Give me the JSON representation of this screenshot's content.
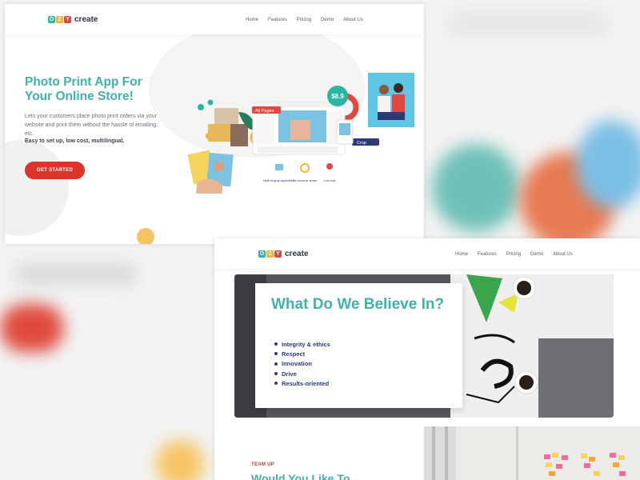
{
  "brand": {
    "letters": [
      "O",
      "Z",
      "Y"
    ],
    "word": "create",
    "colors": [
      "#2bb5a4",
      "#f4b43a",
      "#e2483d"
    ]
  },
  "nav": {
    "items": [
      "Home",
      "Features",
      "Pricing",
      "Demo",
      "About Us"
    ]
  },
  "hero": {
    "title": "Photo Print App For Your Online Store!",
    "description": "Lets your customers place photo print orders via your website and print them without the hassle of emailing, etc.",
    "tagline": "Easy to set up, low cost, multilingual.",
    "cta_label": "GET STARTED",
    "illustration": {
      "all_pages_label": "All Pages",
      "price_label": "$8.9",
      "crop_label": "Crop",
      "features": [
        "Multi-lingual application",
        "No revenue share",
        "Low cost"
      ]
    }
  },
  "about": {
    "title": "What Do We Believe In?",
    "values": [
      "Integrity & ethics",
      "Respect",
      "Innovation",
      "Drive",
      "Results-oriented"
    ]
  },
  "team": {
    "eyebrow": "TEAM UP",
    "title": "Would You Like To"
  },
  "colors": {
    "accent_teal": "#3fb3a4",
    "accent_red": "#d9352b",
    "navy": "#2d3a7a",
    "yellow": "#f4b43a"
  }
}
